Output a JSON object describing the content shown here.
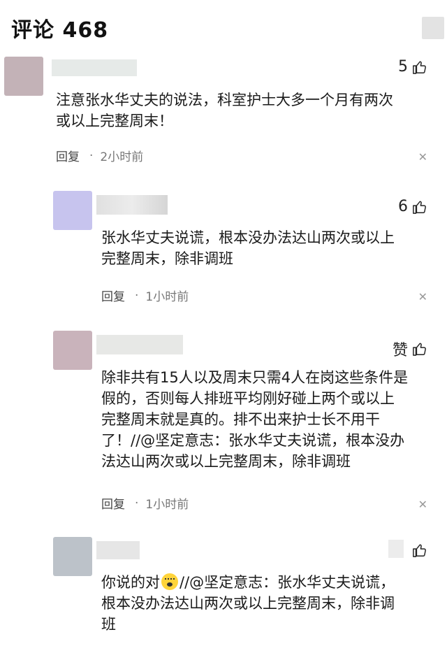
{
  "header": {
    "title": "评论 468"
  },
  "comments": [
    {
      "likes": "5",
      "content_lines": [
        "注意张水华丈夫的说法，科室护士大多一个月有两次",
        "或以上完整周末！"
      ],
      "reply_label": "回复",
      "time": "2小时前",
      "avatar_color": "#c3b2b7"
    },
    {
      "likes": "6",
      "content_lines": [
        "张水华丈夫说谎，根本没办法达山两次或以上",
        "完整周末，除非调班"
      ],
      "reply_label": "回复",
      "time": "1小时前",
      "avatar_color": "#c7c4ee"
    },
    {
      "likes": "赞",
      "content_lines": [
        "除非共有15人以及周末只需4人在岗这些条件是",
        "假的，否则每人排班平均刚好碰上两个或以上",
        "完整周末就是真的。排不出来护士长不用干",
        "了！//@坚定意志：张水华丈夫说谎，根本没办",
        "法达山两次或以上完整周末，除非调班"
      ],
      "reply_label": "回复",
      "time": "1小时前",
      "avatar_color": "#c9b3bb"
    },
    {
      "likes": "",
      "content_line1_before": "你说的对",
      "content_line1_after": "//@坚定意志：张水华丈夫说谎，",
      "content_lines": [
        "根本没办法达山两次或以上完整周末，除非调",
        "班"
      ],
      "avatar_color": "#bcc2c9"
    }
  ]
}
